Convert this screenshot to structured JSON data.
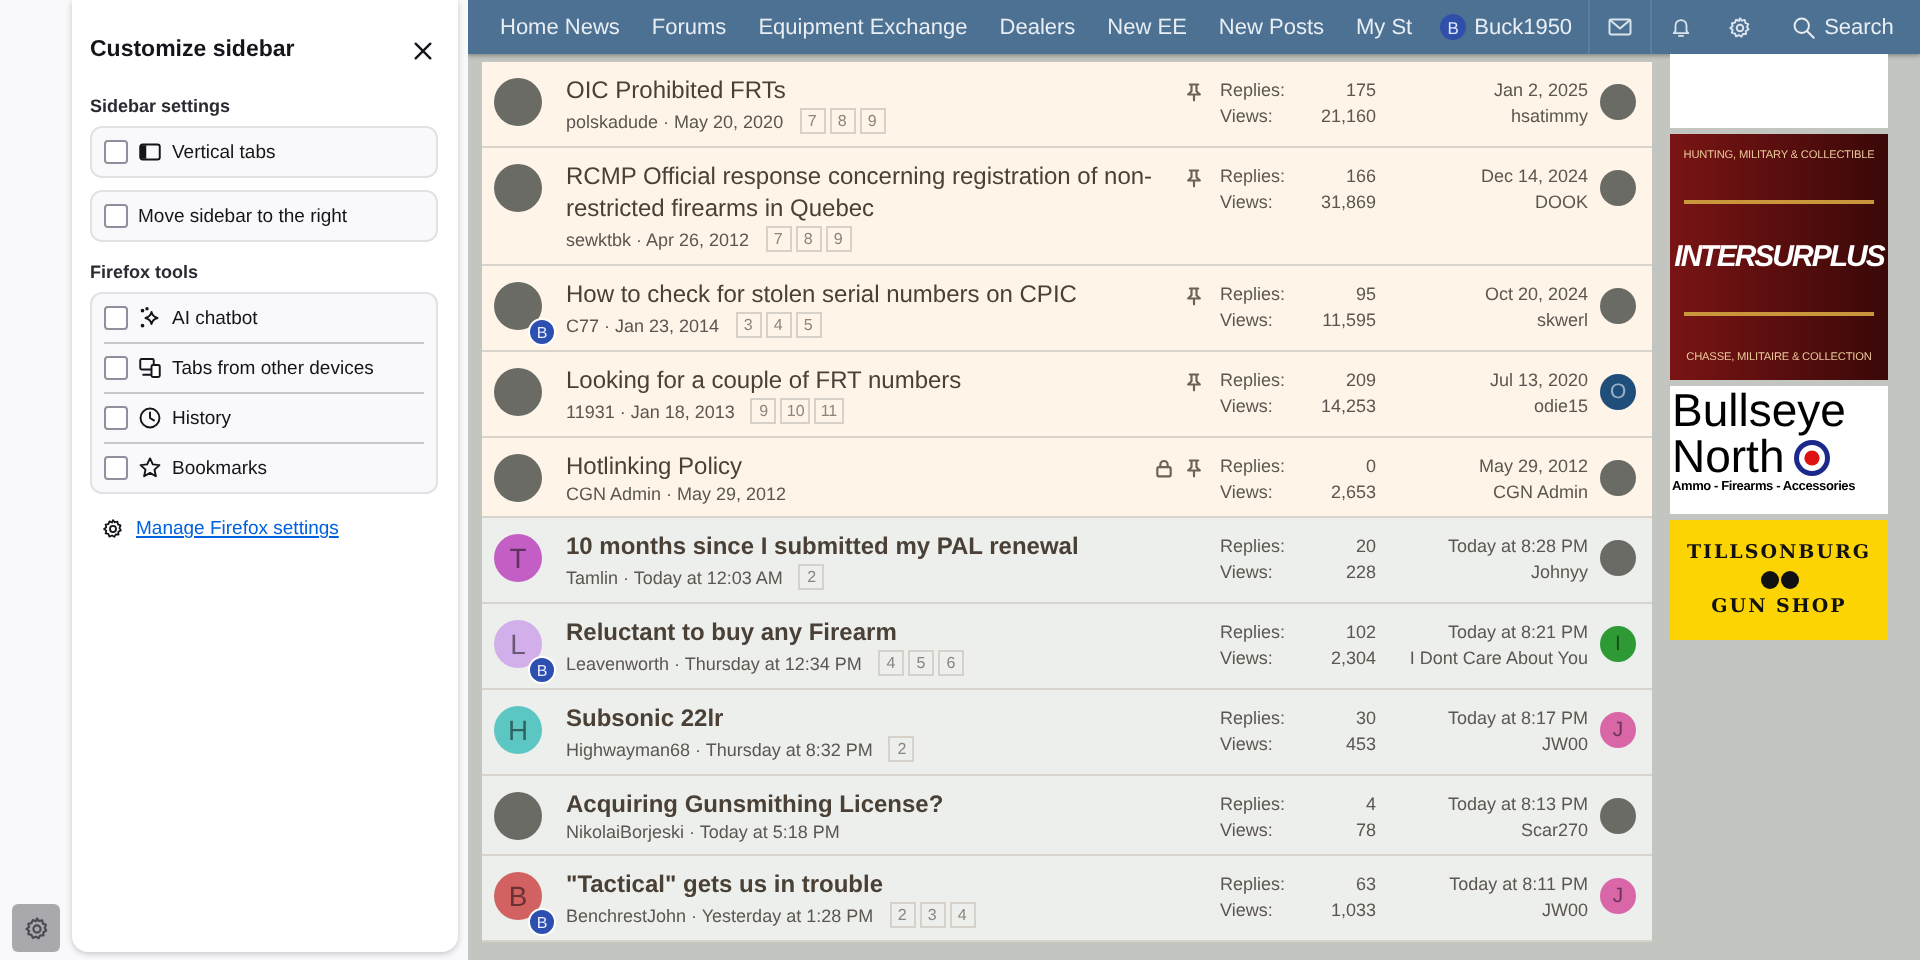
{
  "sidebar_panel": {
    "title": "Customize sidebar",
    "sections": [
      {
        "heading": "Sidebar settings",
        "kind": "separate",
        "options": [
          {
            "label": "Vertical tabs",
            "checked": false,
            "kind": "tabs"
          },
          {
            "label": "Move sidebar to the right",
            "checked": false,
            "kind": "plain"
          }
        ]
      },
      {
        "heading": "Firefox tools",
        "kind": "grouped",
        "options": [
          {
            "label": "AI chatbot",
            "checked": false,
            "kind": "chatbot"
          },
          {
            "label": "Tabs from other devices",
            "checked": false,
            "kind": "synced"
          },
          {
            "label": "History",
            "checked": false,
            "kind": "history"
          },
          {
            "label": "Bookmarks",
            "checked": false,
            "kind": "bookmarks"
          }
        ]
      }
    ],
    "link": "Manage Firefox settings"
  },
  "nav": {
    "items": [
      "Home News",
      "Forums",
      "Equipment Exchange",
      "Dealers",
      "New EE",
      "New Posts",
      "My St"
    ],
    "user": {
      "initial": "B",
      "name": "Buck1950"
    },
    "search": "Search"
  },
  "threads": [
    {
      "title": "OIC Prohibited FRTs",
      "byline": "polskadude · May 20, 2020",
      "pages": [
        "7",
        "8",
        "9"
      ],
      "sticky": true,
      "unread": false,
      "pinned": true,
      "locked": false,
      "replies_label": "Replies:",
      "replies": "175",
      "views_label": "Views:",
      "views": "21,160",
      "last_date": "Jan 2, 2025",
      "last_user": "hsatimmy",
      "avatar": {
        "kind": "photo"
      },
      "last_avatar": {
        "kind": "photo"
      }
    },
    {
      "title": "RCMP Official response concerning registration of non-restricted firearms in Quebec",
      "byline": "sewktbk · Apr 26, 2012",
      "pages": [
        "7",
        "8",
        "9"
      ],
      "sticky": true,
      "unread": false,
      "pinned": true,
      "locked": false,
      "replies_label": "Replies:",
      "replies": "166",
      "views_label": "Views:",
      "views": "31,869",
      "last_date": "Dec 14, 2024",
      "last_user": "DOOK",
      "avatar": {
        "kind": "photo"
      },
      "last_avatar": {
        "kind": "photo"
      }
    },
    {
      "title": "How to check for stolen serial numbers on CPIC",
      "byline": "C77 · Jan 23, 2014",
      "pages": [
        "3",
        "4",
        "5"
      ],
      "sticky": true,
      "unread": false,
      "pinned": true,
      "locked": false,
      "replies_label": "Replies:",
      "replies": "95",
      "views_label": "Views:",
      "views": "11,595",
      "last_date": "Oct 20, 2024",
      "last_user": "skwerl",
      "avatar": {
        "kind": "photo",
        "badge": "B"
      },
      "last_avatar": {
        "kind": "photo"
      }
    },
    {
      "title": "Looking for a couple of FRT numbers",
      "byline": "11931 · Jan 18, 2013",
      "pages": [
        "9",
        "10",
        "11"
      ],
      "sticky": true,
      "unread": false,
      "pinned": true,
      "locked": false,
      "replies_label": "Replies:",
      "replies": "209",
      "views_label": "Views:",
      "views": "14,253",
      "last_date": "Jul 13, 2020",
      "last_user": "odie15",
      "avatar": {
        "kind": "photo"
      },
      "last_avatar": {
        "kind": "letter",
        "letter": "O",
        "color": "#1f4e7a"
      }
    },
    {
      "title": "Hotlinking Policy",
      "byline": "CGN Admin · May 29, 2012",
      "sticky": true,
      "unread": false,
      "pinned": true,
      "locked": true,
      "replies_label": "Replies:",
      "replies": "0",
      "views_label": "Views:",
      "views": "2,653",
      "last_date": "May 29, 2012",
      "last_user": "CGN Admin",
      "avatar": {
        "kind": "photo"
      },
      "last_avatar": {
        "kind": "photo"
      }
    },
    {
      "title": "10 months since I submitted my PAL renewal",
      "byline": "Tamlin · Today at 12:03 AM",
      "pages": [
        "2"
      ],
      "sticky": false,
      "unread": true,
      "pinned": false,
      "locked": false,
      "replies_label": "Replies:",
      "replies": "20",
      "views_label": "Views:",
      "views": "228",
      "last_date": "Today at 8:28 PM",
      "last_user": "Johnyy",
      "avatar": {
        "kind": "letter",
        "letter": "T",
        "color": "#c35fc4"
      },
      "last_avatar": {
        "kind": "photo"
      }
    },
    {
      "title": "Reluctant to buy any Firearm",
      "byline": "Leavenworth · Thursday at 12:34 PM",
      "pages": [
        "4",
        "5",
        "6"
      ],
      "sticky": false,
      "unread": true,
      "pinned": false,
      "locked": false,
      "replies_label": "Replies:",
      "replies": "102",
      "views_label": "Views:",
      "views": "2,304",
      "last_date": "Today at 8:21 PM",
      "last_user": "I Dont Care About You",
      "avatar": {
        "kind": "letter",
        "letter": "L",
        "color": "#d2aeea",
        "badge": "B"
      },
      "last_avatar": {
        "kind": "letter",
        "letter": "I",
        "color": "#2e9a36"
      }
    },
    {
      "title": "Subsonic 22lr",
      "byline": "Highwayman68 · Thursday at 8:32 PM",
      "pages": [
        "2"
      ],
      "sticky": false,
      "unread": true,
      "pinned": false,
      "locked": false,
      "replies_label": "Replies:",
      "replies": "30",
      "views_label": "Views:",
      "views": "453",
      "last_date": "Today at 8:17 PM",
      "last_user": "JW00",
      "avatar": {
        "kind": "letter",
        "letter": "H",
        "color": "#5cc6c3"
      },
      "last_avatar": {
        "kind": "letter",
        "letter": "J",
        "color": "#d967a8"
      }
    },
    {
      "title": "Acquiring Gunsmithing License?",
      "byline": "NikolaiBorjeski · Today at 5:18 PM",
      "sticky": false,
      "unread": true,
      "pinned": false,
      "locked": false,
      "replies_label": "Replies:",
      "replies": "4",
      "views_label": "Views:",
      "views": "78",
      "last_date": "Today at 8:13 PM",
      "last_user": "Scar270",
      "avatar": {
        "kind": "photo"
      },
      "last_avatar": {
        "kind": "photo"
      }
    },
    {
      "title": "\"Tactical\" gets us in trouble",
      "byline": "BenchrestJohn · Yesterday at 1:28 PM",
      "pages": [
        "2",
        "3",
        "4"
      ],
      "sticky": false,
      "unread": true,
      "pinned": false,
      "locked": false,
      "replies_label": "Replies:",
      "replies": "63",
      "views_label": "Views:",
      "views": "1,033",
      "last_date": "Today at 8:11 PM",
      "last_user": "JW00",
      "avatar": {
        "kind": "letter",
        "letter": "B",
        "color": "#d26262",
        "badge": "B"
      },
      "last_avatar": {
        "kind": "letter",
        "letter": "J",
        "color": "#d967a8"
      }
    }
  ],
  "ads": [
    {
      "kind": "surplus",
      "top": "HUNTING, MILITARY & COLLECTIBLE",
      "name": "INTERSURPLUS",
      "bottom": "CHASSE, MILITAIRE & COLLECTION"
    },
    {
      "kind": "bullseye",
      "line1": "Bullseye",
      "line2": "North",
      "tagline": "Ammo - Firearms - Accessories"
    },
    {
      "kind": "gunshop",
      "line1": "TILLSONBURG",
      "line2": "GUN SHOP"
    }
  ]
}
